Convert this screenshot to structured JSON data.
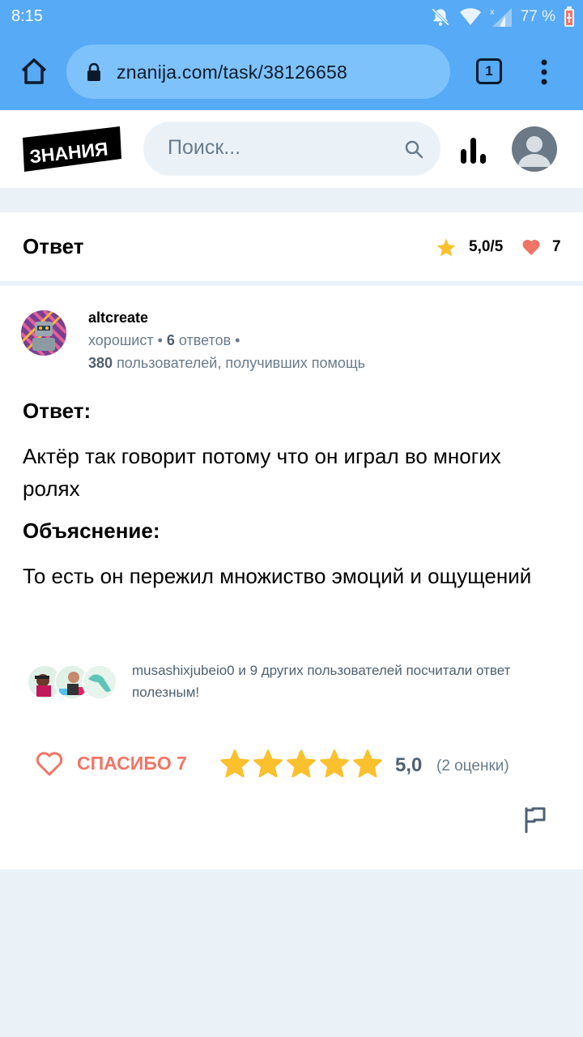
{
  "status_bar": {
    "time": "8:15",
    "battery": "77 %"
  },
  "browser": {
    "url": "znanija.com/task/38126658",
    "tab_count": "1"
  },
  "header": {
    "logo_text": "ЗНАНИЯ",
    "search_placeholder": "Поиск..."
  },
  "answer_header": {
    "title": "Ответ",
    "rating": "5,0/5",
    "likes": "7"
  },
  "author": {
    "name": "altcreate",
    "rank": "хорошист",
    "answers_count": "6",
    "answers_label": "ответов",
    "helped_count": "380",
    "helped_label": "пользователей, получивших помощь"
  },
  "answer": {
    "answer_label": "Ответ:",
    "answer_text": "Актёр так говорит потому что он играл во многих ролях",
    "explanation_label": "Объяснение:",
    "explanation_text": "То есть он пережил множиство эмоций и ощущений"
  },
  "helpful": {
    "text": "musashixjubeio0 и 9 других пользователей посчитали ответ полезным!"
  },
  "actions": {
    "thanks_label": "СПАСИБО 7",
    "rating_value": "5,0",
    "rating_count": "(2 оценки)",
    "stars": 5
  },
  "colors": {
    "browser_blue": "#57aaf5",
    "accent_coral": "#f07566",
    "star_yellow": "#fbc02d",
    "page_bg": "#ebf2f7"
  }
}
